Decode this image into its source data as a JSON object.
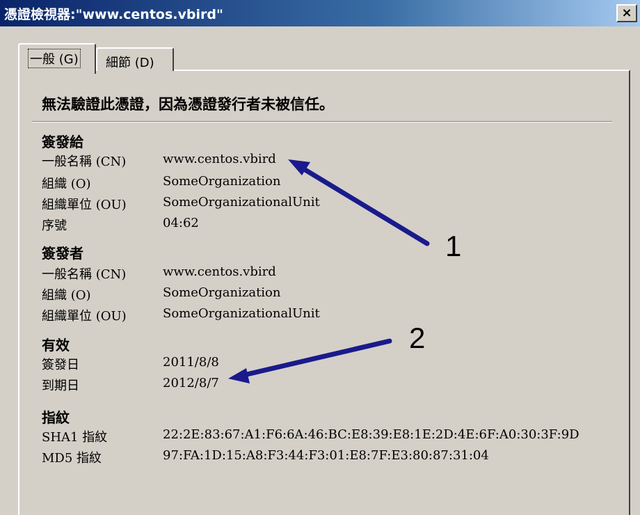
{
  "window": {
    "title": "憑證檢視器:\"www.centos.vbird\"",
    "close_label": "×"
  },
  "tabs": [
    {
      "label": "一般 (G)"
    },
    {
      "label": "細節 (D)"
    }
  ],
  "warning": "無法驗證此憑證，因為憑證發行者未被信任。",
  "issued_to": {
    "heading": "簽發給",
    "rows": [
      {
        "label": "一般名稱 (CN)",
        "value": "www.centos.vbird"
      },
      {
        "label": "組織 (O)",
        "value": "SomeOrganization"
      },
      {
        "label": "組織單位 (OU)",
        "value": "SomeOrganizationalUnit"
      },
      {
        "label": "序號",
        "value": "04:62"
      }
    ]
  },
  "issued_by": {
    "heading": "簽發者",
    "rows": [
      {
        "label": "一般名稱 (CN)",
        "value": "www.centos.vbird"
      },
      {
        "label": "組織 (O)",
        "value": "SomeOrganization"
      },
      {
        "label": "組織單位 (OU)",
        "value": "SomeOrganizationalUnit"
      }
    ]
  },
  "validity": {
    "heading": "有效",
    "rows": [
      {
        "label": "簽發日",
        "value": "2011/8/8"
      },
      {
        "label": "到期日",
        "value": "2012/8/7"
      }
    ]
  },
  "fingerprints": {
    "heading": "指紋",
    "rows": [
      {
        "label": "SHA1 指紋",
        "value": "22:2E:83:67:A1:F6:6A:46:BC:E8:39:E8:1E:2D:4E:6F:A0:30:3F:9D"
      },
      {
        "label": "MD5 指紋",
        "value": "97:FA:1D:15:A8:F3:44:F3:01:E8:7F:E3:80:87:31:04"
      }
    ]
  },
  "annotations": [
    {
      "label": "1"
    },
    {
      "label": "2"
    }
  ],
  "colors": {
    "arrow": "#1a1a8c",
    "titlebar_start": "#0a246a",
    "dialog_bg": "#d4d0c8"
  }
}
